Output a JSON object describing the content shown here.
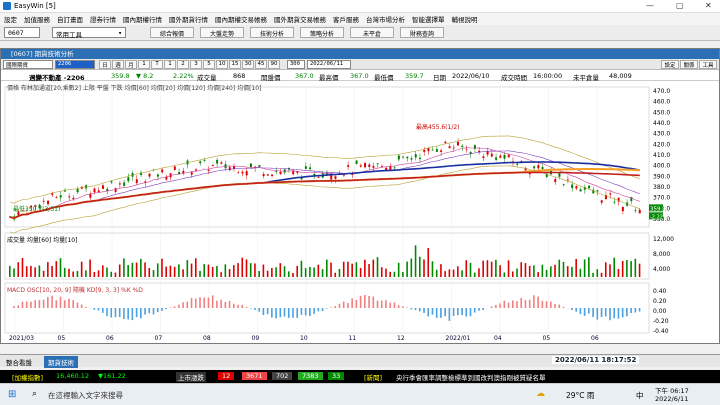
{
  "app": {
    "title": "EasyWin  [5]"
  },
  "menu": [
    "設定",
    "加值服務",
    "自訂畫面",
    "證券行情",
    "國內期權行情",
    "國外期貨行情",
    "國內期權交易帳務",
    "國外期貨交易帳務",
    "客戶服務",
    "台灣市場分析",
    "智能選擇單",
    "輔視說明"
  ],
  "toolbar": {
    "symbol": "0607",
    "tool_select": "常用工具",
    "buttons": [
      "綜合報價",
      "大盤走勢",
      "技術分析",
      "策略分析",
      "未平倉",
      "財務查詢"
    ]
  },
  "chart_window": {
    "title": "[0607] 期貨技術分析",
    "product": "國際期貨",
    "code": "2206",
    "periods": [
      "日",
      "週",
      "月",
      "1",
      "T",
      "1",
      "2",
      "3",
      "5",
      "10",
      "15",
      "30",
      "45",
      "90"
    ],
    "count": "300",
    "date": "2022/06/11",
    "right_buttons": [
      "設定",
      "關係",
      "工具"
    ]
  },
  "info": {
    "name": "週變不動產 -2206",
    "price": "359.8",
    "change": "▼ 8.2",
    "pct": "2.22%",
    "vol_label": "成交量",
    "vol": "868",
    "open_label": "開盤價",
    "open": "367.0",
    "high_label": "最高價",
    "high": "367.0",
    "low_label": "最低價",
    "low": "359.7",
    "date_label": "日期",
    "date": "2022/06/10",
    "time_label": "成交時間",
    "time": "16:00:00",
    "oi_label": "未平倉量",
    "oi": "48,009"
  },
  "legends": {
    "price": "價格  布林加通道[20,乘數2] 上限  平盤  下跌  均價[60]  均價[20]  均價[120]  均價[240]  均價[10]",
    "volume": "成交量  均量[60]  均量[10]",
    "macd": "MACD OSC[10, 20, 9]  隨機 KD[9, 3, 3]  %K  %D"
  },
  "annotations": {
    "high": "最高455.6(1/2)",
    "low": "最低350.7(3/31)"
  },
  "price_axis": [
    "470.0",
    "460.0",
    "450.0",
    "440.0",
    "430.0",
    "420.0",
    "410.0",
    "400.0",
    "390.0",
    "380.0",
    "370.0",
    "360.0",
    "350.0"
  ],
  "last_price_tag": "359.8",
  "last_pct_tag": "-2.22%",
  "vol_axis": [
    "12,000",
    "8,000",
    "4,000"
  ],
  "macd_axis": [
    "0.40",
    "0.20",
    "0.00",
    "-0.20",
    "-0.40"
  ],
  "x_labels": [
    "2021/03",
    "05",
    "06",
    "07",
    "08",
    "09",
    "10",
    "11",
    "12",
    "2022/01",
    "04",
    "05",
    "06"
  ],
  "bottom_tabs": [
    "整合看盤",
    "期貨技術"
  ],
  "clock": "2022/06/11 18:17:52",
  "status": {
    "index_label": "[加權指數]",
    "index": "16,460.12",
    "index_chg": "▼161.22",
    "rise_label": "上市漲跌",
    "c1": "12",
    "c2": "3671",
    "c3": "702",
    "c4": "7383",
    "c5": "33",
    "news_label": "[新聞]",
    "news": "央行季會匯率調整檢標準到國改判澳指剛被質疑名單"
  },
  "taskbar": {
    "search": "在這裡輸入文字來搜尋",
    "weather": "29°C 雨",
    "time": "下午 06:17",
    "date": "2022/6/11",
    "lang": "中"
  },
  "colors": {
    "title": "#2b6fb5",
    "up": "#e00000",
    "down": "#008000",
    "ma_blue": "#1a2fa0",
    "ma_orange": "#f5a020"
  },
  "chart_data": {
    "type": "line",
    "x": [
      "2021/03",
      "05",
      "06",
      "07",
      "08",
      "09",
      "10",
      "11",
      "12",
      "2022/01",
      "04",
      "05",
      "06"
    ],
    "ylim": [
      350,
      470
    ],
    "series": [
      {
        "values": [
          352,
          372,
          381,
          392,
          400,
          398,
          392,
          396,
          402,
          420,
          410,
          395,
          375,
          360
        ]
      },
      {
        "values": [
          355,
          360,
          370,
          378,
          386,
          390,
          393,
          396,
          400,
          404,
          404,
          400,
          394,
          388
        ]
      }
    ]
  }
}
